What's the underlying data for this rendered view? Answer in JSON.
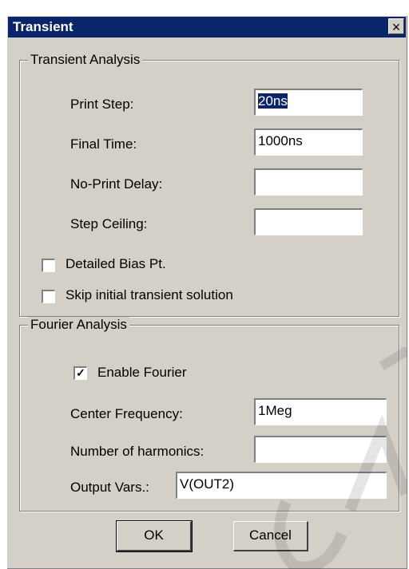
{
  "dialog": {
    "title": "Transient",
    "close_label": "×"
  },
  "transient": {
    "legend": "Transient Analysis",
    "print_step_label": "Print Step:",
    "print_step_value": "20ns",
    "final_time_label": "Final Time:",
    "final_time_value": "1000ns",
    "no_print_delay_label": "No-Print Delay:",
    "no_print_delay_value": "",
    "step_ceiling_label": "Step Ceiling:",
    "step_ceiling_value": "",
    "detailed_bias_label": "Detailed Bias Pt.",
    "detailed_bias_checked": false,
    "skip_initial_label": "Skip initial transient solution",
    "skip_initial_checked": false
  },
  "fourier": {
    "legend": "Fourier Analysis",
    "enable_label": "Enable Fourier",
    "enable_checked": true,
    "center_freq_label": "Center Frequency:",
    "center_freq_value": "1Meg",
    "harmonics_label": "Number of harmonics:",
    "harmonics_value": "",
    "output_vars_label": "Output Vars.:",
    "output_vars_value": "V(OUT2)"
  },
  "buttons": {
    "ok": "OK",
    "cancel": "Cancel"
  }
}
